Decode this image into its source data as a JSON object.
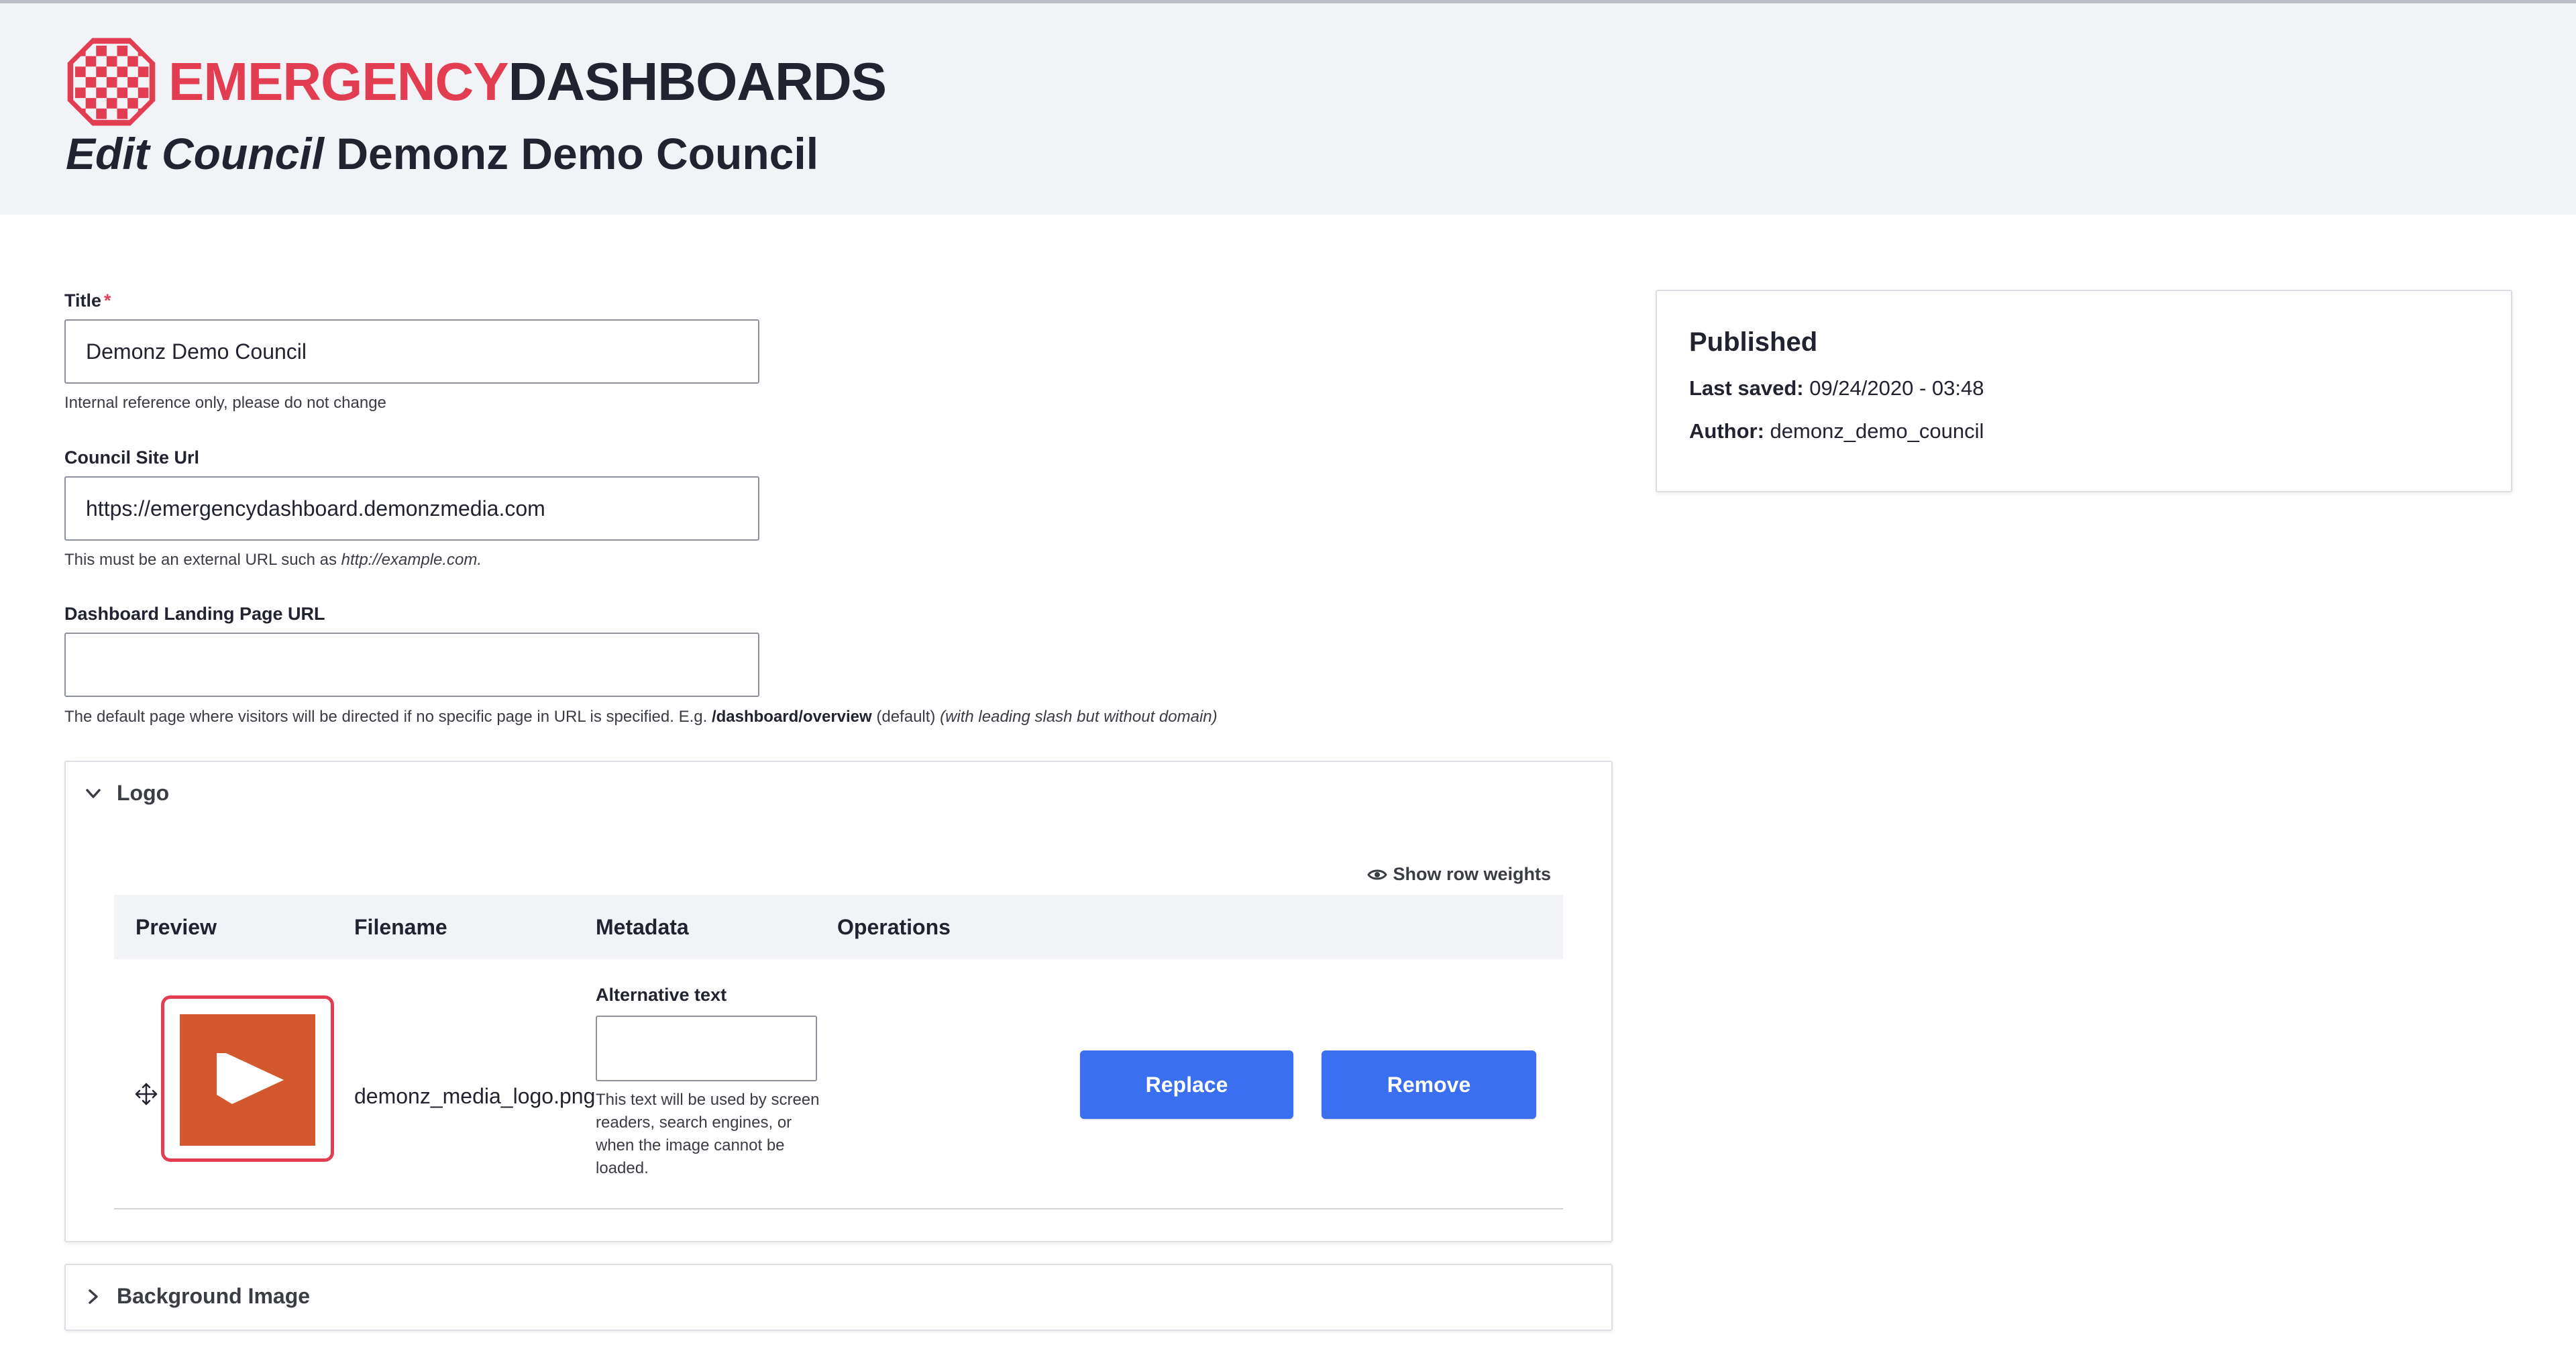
{
  "brand": {
    "name_part1": "EMERGENCY",
    "name_part2": "DASHBOARDS",
    "accent_color": "#e23d51",
    "logo_icon": "checkered-octagon-icon"
  },
  "page": {
    "title_prefix": "Edit Council",
    "title_name": "Demonz Demo Council"
  },
  "form": {
    "title": {
      "label": "Title",
      "required_marker": "*",
      "value": "Demonz Demo Council",
      "description": "Internal reference only, please do not change"
    },
    "council_site_url": {
      "label": "Council Site Url",
      "value": "https://emergencydashboard.demonzmedia.com",
      "description_prefix": "This must be an external URL such as",
      "description_example": "http://example.com."
    },
    "landing_page_url": {
      "label": "Dashboard Landing Page URL",
      "value": "",
      "description_prefix": "The default page where visitors will be directed if no specific page in URL is specified. E.g.",
      "description_path": "/dashboard/overview",
      "description_default": "(default)",
      "description_note": "(with leading slash but without domain)"
    }
  },
  "logo_section": {
    "summary": "Logo",
    "expanded": true,
    "show_row_weights": "Show row weights",
    "columns": [
      "Preview",
      "Filename",
      "Metadata",
      "Operations"
    ],
    "row": {
      "filename": "demonz_media_logo.png",
      "alt_label": "Alternative text",
      "alt_value": "",
      "alt_description": "This text will be used by screen readers, search engines, or when the image cannot be loaded.",
      "replace_label": "Replace",
      "remove_label": "Remove"
    }
  },
  "background_section": {
    "summary": "Background Image",
    "expanded": false
  },
  "sidebar": {
    "status": "Published",
    "last_saved_label": "Last saved:",
    "last_saved_value": "09/24/2020 - 03:48",
    "author_label": "Author:",
    "author_value": "demonz_demo_council"
  },
  "colors": {
    "button": "#3a6ff0",
    "header_bg": "#f2f3f7",
    "thumbnail": "#d4582e"
  }
}
